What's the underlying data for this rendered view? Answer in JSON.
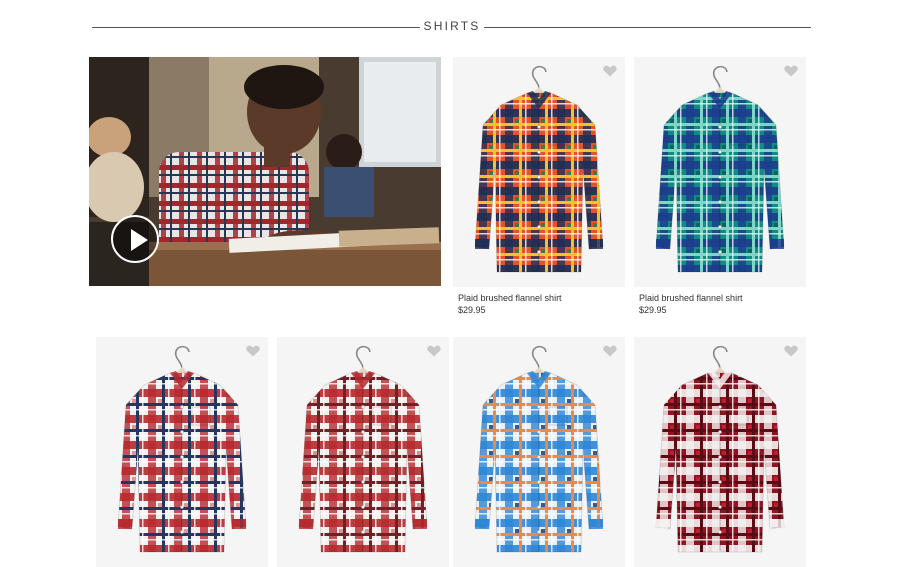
{
  "section": {
    "title": "SHIRTS"
  },
  "video": {
    "play_icon": "play-icon"
  },
  "colors": {
    "rule": "#555555",
    "tile_bg": "#f5f5f5"
  },
  "products": [
    {
      "name": "Plaid brushed flannel shirt",
      "price": "$29.95",
      "palette": "orange-navy"
    },
    {
      "name": "Plaid brushed flannel shirt",
      "price": "$29.95",
      "palette": "teal-blue"
    },
    {
      "name": "",
      "price": "",
      "palette": "red-navy-white"
    },
    {
      "name": "",
      "price": "",
      "palette": "red-white"
    },
    {
      "name": "",
      "price": "",
      "palette": "blue-orange"
    },
    {
      "name": "",
      "price": "",
      "palette": "red-white-check"
    }
  ]
}
